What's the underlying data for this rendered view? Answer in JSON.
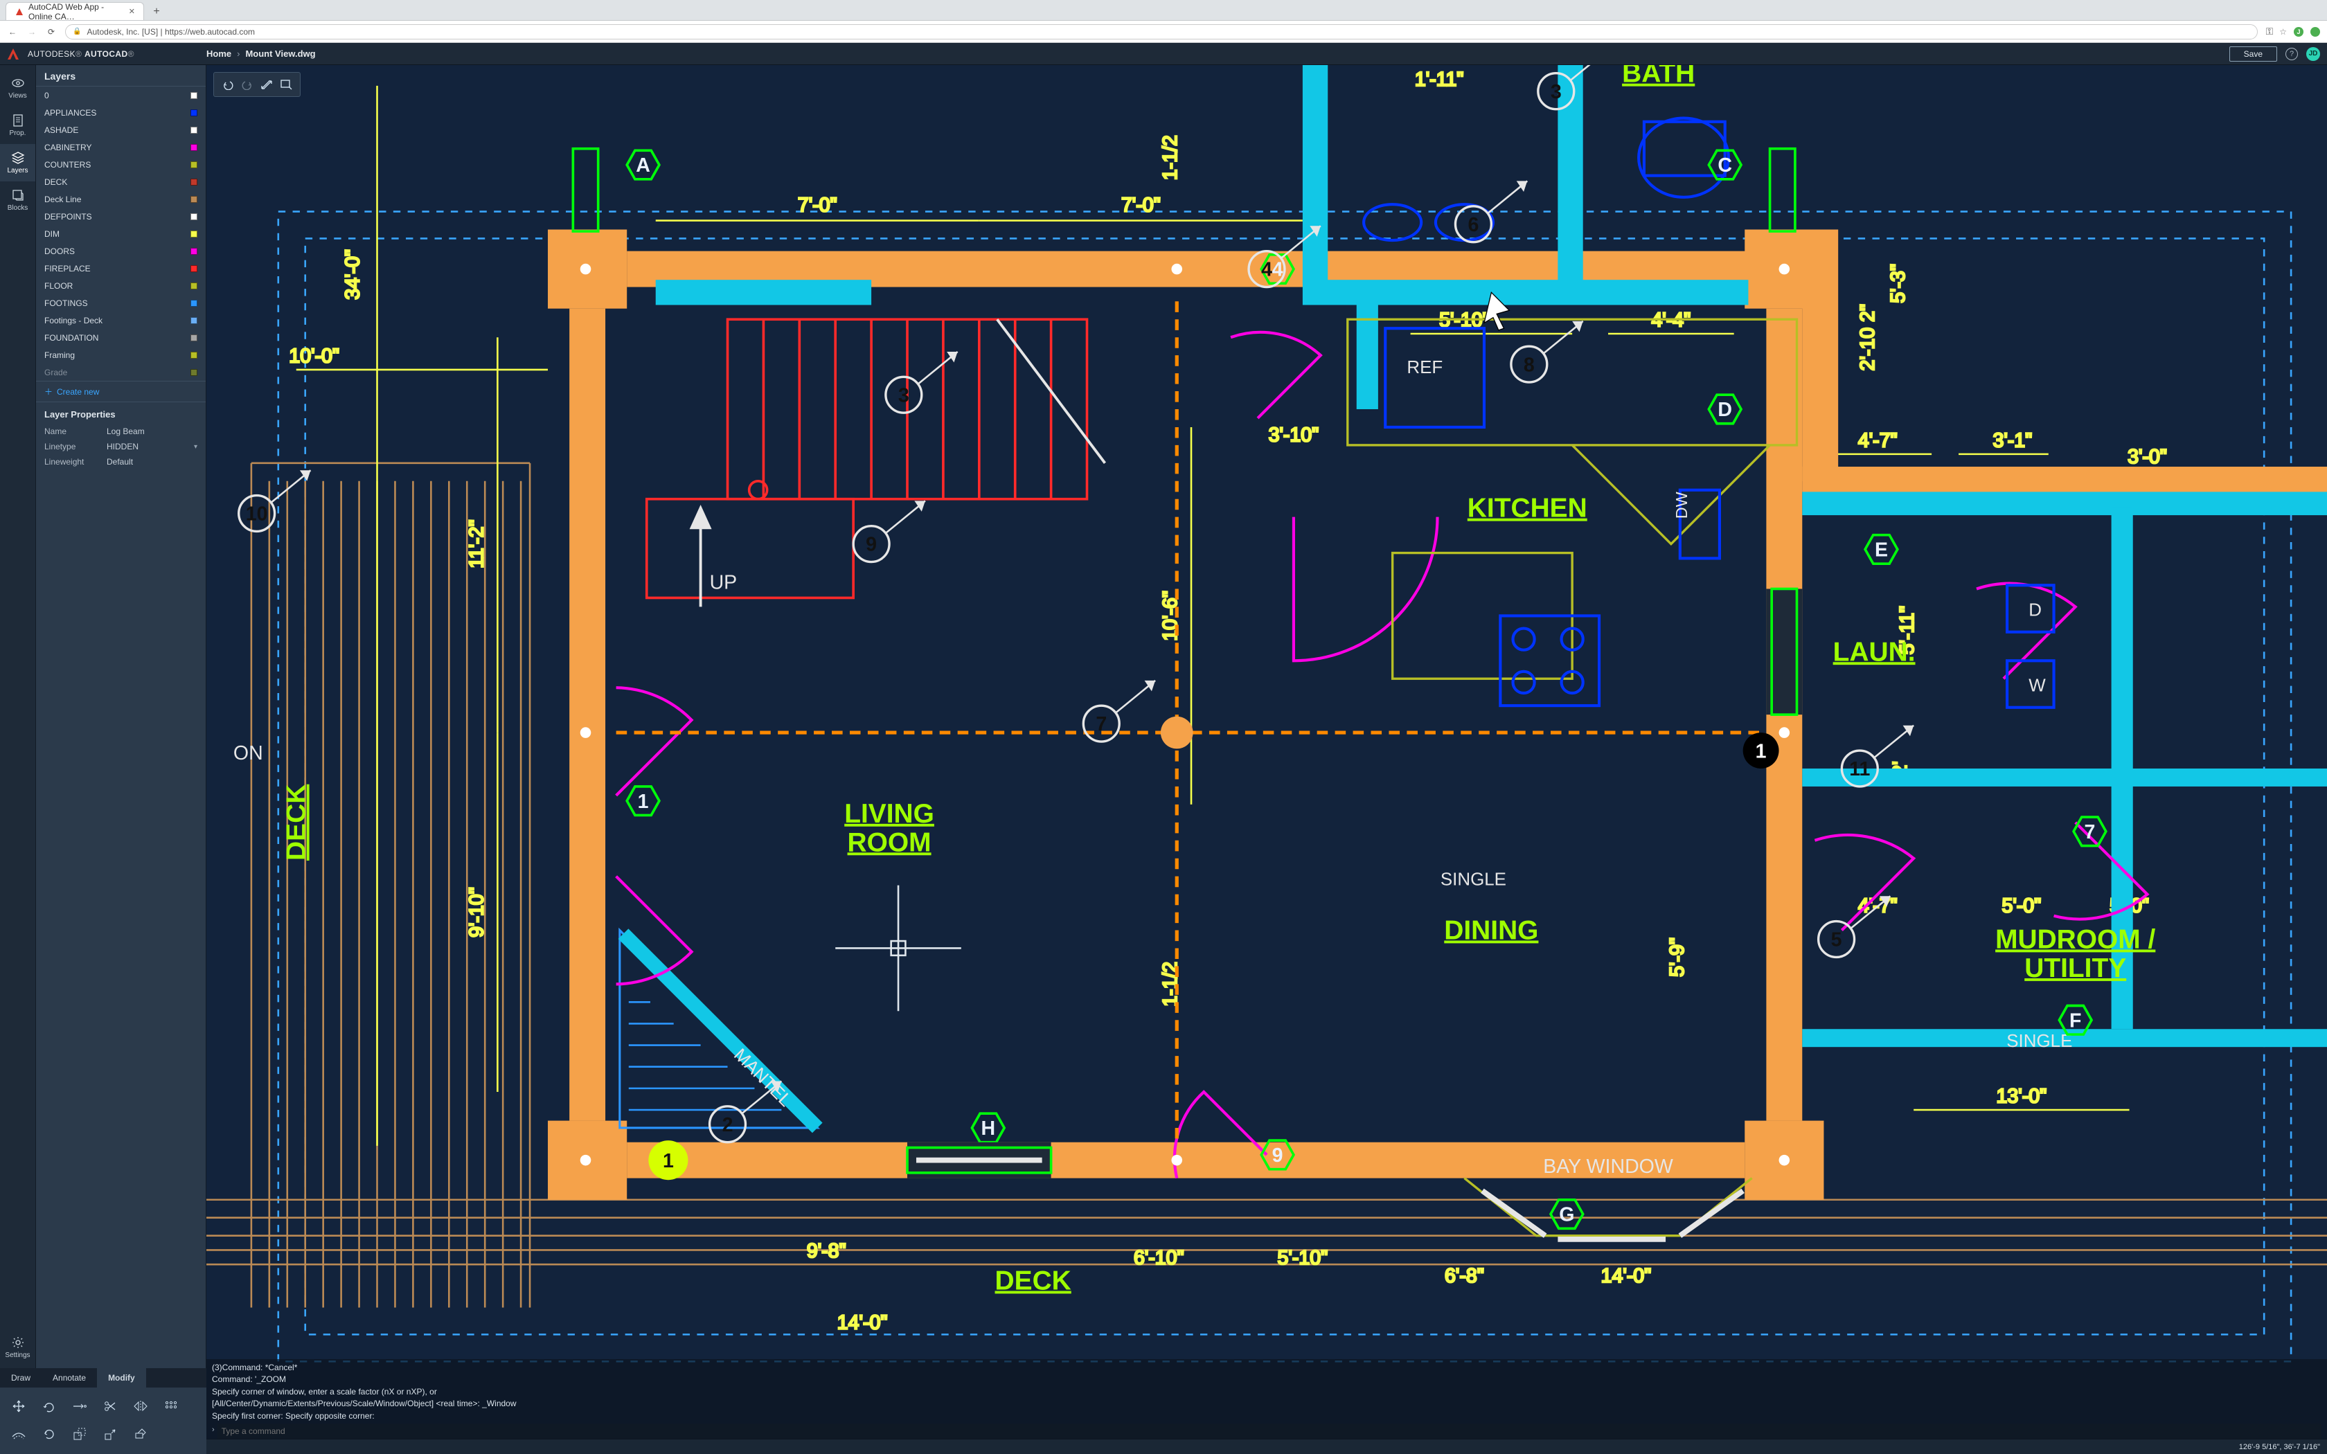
{
  "browser": {
    "tab_title": "AutoCAD Web App - Online CA…",
    "url_display": "Autodesk, Inc. [US] | https://web.autocad.com"
  },
  "app": {
    "brand_html": "AUTODESK<span style='opacity:.6'>®</span> <b>AUTOCAD</b><span style='opacity:.6'>®</span>",
    "breadcrumb_home": "Home",
    "breadcrumb_file": "Mount View.dwg",
    "save_label": "Save",
    "avatar_initials": "JD"
  },
  "rail": {
    "items": [
      {
        "id": "views",
        "label": "Views"
      },
      {
        "id": "props",
        "label": "Prop."
      },
      {
        "id": "layers",
        "label": "Layers"
      },
      {
        "id": "blocks",
        "label": "Blocks"
      }
    ],
    "settings_label": "Settings"
  },
  "layers_panel": {
    "title": "Layers",
    "items": [
      {
        "name": "0",
        "color": "#ffffff"
      },
      {
        "name": "APPLIANCES",
        "color": "#0033ff"
      },
      {
        "name": "ASHADE",
        "color": "#ffffff"
      },
      {
        "name": "CABINETRY",
        "color": "#ff00e4"
      },
      {
        "name": "COUNTERS",
        "color": "#b7bf26"
      },
      {
        "name": "DECK",
        "color": "#c0392b"
      },
      {
        "name": "Deck Line",
        "color": "#bb8a55"
      },
      {
        "name": "DEFPOINTS",
        "color": "#ffffff"
      },
      {
        "name": "DIM",
        "color": "#f6ff4c"
      },
      {
        "name": "DOORS",
        "color": "#ff00e4"
      },
      {
        "name": "FIREPLACE",
        "color": "#ff2a2a"
      },
      {
        "name": "FLOOR",
        "color": "#b7bf26"
      },
      {
        "name": "FOOTINGS",
        "color": "#2b96ff"
      },
      {
        "name": "Footings - Deck",
        "color": "#6aaef5"
      },
      {
        "name": "FOUNDATION",
        "color": "#a6a6a6"
      },
      {
        "name": "Framing",
        "color": "#b7bf26"
      },
      {
        "name": "Grade",
        "color": "#6e7a2d"
      }
    ],
    "create_new": "Create new",
    "props_title": "Layer Properties",
    "prop_name_label": "Name",
    "prop_name_value": "Log Beam",
    "prop_linetype_label": "Linetype",
    "prop_linetype_value": "HIDDEN",
    "prop_lineweight_label": "Lineweight",
    "prop_lineweight_value": "Default"
  },
  "tooltabs": {
    "draw": "Draw",
    "annotate": "Annotate",
    "modify": "Modify"
  },
  "drawing": {
    "rooms": {
      "living": "LIVING ROOM",
      "dining": "DINING",
      "kitchen": "KITCHEN",
      "bath": "BATH",
      "laun": "LAUN.",
      "mud": "MUDROOM / UTILITY",
      "deck": "DECK",
      "bay": "BAY WINDOW"
    },
    "labels": {
      "up": "UP",
      "mantel": "MANTEL",
      "ref": "REF",
      "dw": "DW",
      "single": "SINGLE",
      "single2": "SINGLE",
      "on": "ON",
      "deck_side": "DECK",
      "w": "W",
      "d": "D"
    },
    "dims": {
      "d1": "7'-0\"",
      "d2": "7'-0\"",
      "d3": "10'-0\"",
      "d4": "34'-0\"",
      "d5": "1'-11\"",
      "d6": "5'-10\"",
      "d7": "4'-4\"",
      "d8": "3'-10\"",
      "d9": "10'-6\"",
      "d10": "11'-2\"",
      "d11": "9'-10\"",
      "d12": "1-1/2",
      "d13": "1-1/2",
      "d14": "2'-10 2\"",
      "d15": "4'-7\"",
      "d16": "3'-1\"",
      "d17": "5'-11\"",
      "d18": "13'-0\"",
      "d19": "5'-0\"",
      "d20": "5'-0\"",
      "d21": "4'-7\"",
      "d22": "5'-9\"",
      "d23": "6'-10\"",
      "d24": "5'-10\"",
      "d25": "6'-8\"",
      "d26": "14'-0\"",
      "d27": "9'-8\"",
      "d28": "14'-0\"",
      "d29": "2'",
      "d30": "5'-3\"",
      "d31": "3'-0\""
    },
    "hexes": [
      "A",
      "C",
      "D",
      "E",
      "H",
      "G",
      "F",
      "1",
      "4",
      "7",
      "9"
    ],
    "circles": [
      "1",
      "2",
      "3",
      "4",
      "5",
      "6",
      "7",
      "8",
      "9",
      "10",
      "11",
      "1",
      "3"
    ]
  },
  "cmd": {
    "h1": "(3)Command: *Cancel*",
    "h2": "Command: '_ZOOM",
    "h3": "Specify corner of window, enter a scale factor (nX or nXP), or",
    "h4": "[All/Center/Dynamic/Extents/Previous/Scale/Window/Object] <real time>:  _Window",
    "h5": "Specify first corner: Specify opposite corner:",
    "placeholder": "Type a command"
  },
  "status": {
    "coords": "126'-9 5/16\", 36'-7 1/16\""
  }
}
